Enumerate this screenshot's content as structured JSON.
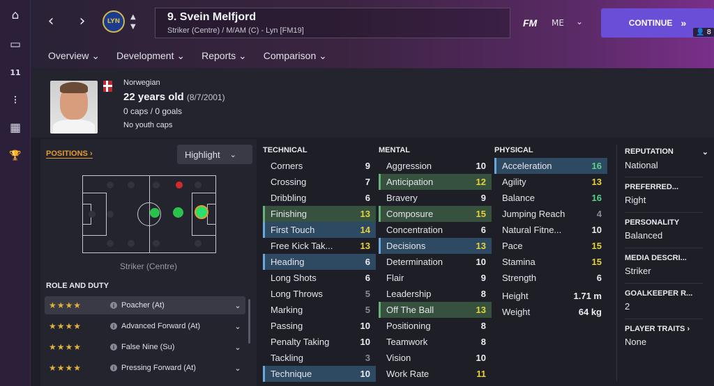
{
  "sidebar": {
    "items": [
      {
        "icon": "home-icon",
        "glyph": "⌂"
      },
      {
        "icon": "inbox-icon",
        "glyph": "▭"
      },
      {
        "icon": "kit-icon",
        "glyph": "11"
      },
      {
        "icon": "tactics-icon",
        "glyph": "⁝"
      },
      {
        "icon": "calendar-icon",
        "glyph": "▦"
      },
      {
        "icon": "trophy-icon",
        "glyph": "🏆"
      }
    ]
  },
  "header": {
    "back": "‹",
    "forward": "›",
    "club_logo_text": "LYN",
    "player_title": "9. Svein Melfjord",
    "player_subtitle": "Striker (Centre) / M/AM (C) - Lyn [FM19]",
    "fm_label": "FM",
    "me_label": "ME",
    "continue_label": "CONTINUE",
    "continue_badge": "8"
  },
  "tabs": [
    {
      "label": "Overview"
    },
    {
      "label": "Development"
    },
    {
      "label": "Reports"
    },
    {
      "label": "Comparison"
    }
  ],
  "profile": {
    "nationality": "Norwegian",
    "age": "22 years old",
    "dob": "(8/7/2001)",
    "caps": "0 caps / 0 goals",
    "youth": "No youth caps"
  },
  "positions": {
    "link_label": "POSITIONS",
    "highlight_label": "Highlight",
    "position_name": "Striker (Centre)",
    "role_title": "ROLE AND DUTY",
    "roles": [
      {
        "name": "Poacher (At)",
        "stars": "★★★★",
        "selected": true
      },
      {
        "name": "Advanced Forward (At)",
        "stars": "★★★★",
        "selected": false
      },
      {
        "name": "False Nine (Su)",
        "stars": "★★★★",
        "selected": false
      },
      {
        "name": "Pressing Forward (At)",
        "stars": "★★★★",
        "selected": false
      }
    ]
  },
  "attributes": {
    "technical_title": "TECHNICAL",
    "mental_title": "MENTAL",
    "physical_title": "PHYSICAL",
    "technical": [
      {
        "name": "Corners",
        "value": "9",
        "hl": "",
        "color": ""
      },
      {
        "name": "Crossing",
        "value": "7",
        "hl": "",
        "color": ""
      },
      {
        "name": "Dribbling",
        "value": "6",
        "hl": "",
        "color": ""
      },
      {
        "name": "Finishing",
        "value": "13",
        "hl": "green",
        "color": "y"
      },
      {
        "name": "First Touch",
        "value": "14",
        "hl": "blue",
        "color": "y"
      },
      {
        "name": "Free Kick Tak...",
        "value": "13",
        "hl": "",
        "color": "y"
      },
      {
        "name": "Heading",
        "value": "6",
        "hl": "blue",
        "color": ""
      },
      {
        "name": "Long Shots",
        "value": "6",
        "hl": "",
        "color": ""
      },
      {
        "name": "Long Throws",
        "value": "5",
        "hl": "",
        "color": "lo"
      },
      {
        "name": "Marking",
        "value": "5",
        "hl": "",
        "color": "lo"
      },
      {
        "name": "Passing",
        "value": "10",
        "hl": "",
        "color": ""
      },
      {
        "name": "Penalty Taking",
        "value": "10",
        "hl": "",
        "color": ""
      },
      {
        "name": "Tackling",
        "value": "3",
        "hl": "",
        "color": "lo"
      },
      {
        "name": "Technique",
        "value": "10",
        "hl": "blue",
        "color": ""
      }
    ],
    "mental": [
      {
        "name": "Aggression",
        "value": "10",
        "hl": "",
        "color": ""
      },
      {
        "name": "Anticipation",
        "value": "12",
        "hl": "green",
        "color": "y"
      },
      {
        "name": "Bravery",
        "value": "9",
        "hl": "",
        "color": ""
      },
      {
        "name": "Composure",
        "value": "15",
        "hl": "green",
        "color": "y"
      },
      {
        "name": "Concentration",
        "value": "6",
        "hl": "",
        "color": ""
      },
      {
        "name": "Decisions",
        "value": "13",
        "hl": "blue",
        "color": "y"
      },
      {
        "name": "Determination",
        "value": "10",
        "hl": "",
        "color": ""
      },
      {
        "name": "Flair",
        "value": "9",
        "hl": "",
        "color": ""
      },
      {
        "name": "Leadership",
        "value": "8",
        "hl": "",
        "color": ""
      },
      {
        "name": "Off The Ball",
        "value": "13",
        "hl": "green",
        "color": "y"
      },
      {
        "name": "Positioning",
        "value": "8",
        "hl": "",
        "color": ""
      },
      {
        "name": "Teamwork",
        "value": "8",
        "hl": "",
        "color": ""
      },
      {
        "name": "Vision",
        "value": "10",
        "hl": "",
        "color": ""
      },
      {
        "name": "Work Rate",
        "value": "11",
        "hl": "",
        "color": "y"
      }
    ],
    "physical": [
      {
        "name": "Acceleration",
        "value": "16",
        "hl": "blue",
        "color": "g"
      },
      {
        "name": "Agility",
        "value": "13",
        "hl": "",
        "color": "y"
      },
      {
        "name": "Balance",
        "value": "16",
        "hl": "",
        "color": "g"
      },
      {
        "name": "Jumping Reach",
        "value": "4",
        "hl": "",
        "color": "lo"
      },
      {
        "name": "Natural Fitne...",
        "value": "10",
        "hl": "",
        "color": ""
      },
      {
        "name": "Pace",
        "value": "15",
        "hl": "",
        "color": "y"
      },
      {
        "name": "Stamina",
        "value": "15",
        "hl": "",
        "color": "y"
      },
      {
        "name": "Strength",
        "value": "6",
        "hl": "",
        "color": ""
      }
    ],
    "height_label": "Height",
    "height": "1.71 m",
    "weight_label": "Weight",
    "weight": "64 kg"
  },
  "info": [
    {
      "key": "REPUTATION",
      "value": "National"
    },
    {
      "key": "PREFERRED...",
      "value": "Right"
    },
    {
      "key": "PERSONALITY",
      "value": "Balanced"
    },
    {
      "key": "MEDIA DESCRI...",
      "value": "Striker"
    },
    {
      "key": "GOALKEEPER R...",
      "value": "2"
    },
    {
      "key": "PLAYER TRAITS",
      "value": "None"
    }
  ],
  "colors": {
    "accent": "#e59a32",
    "continue": "#6a4ed8",
    "good": "#5ad28a",
    "mid": "#e8d23a"
  }
}
